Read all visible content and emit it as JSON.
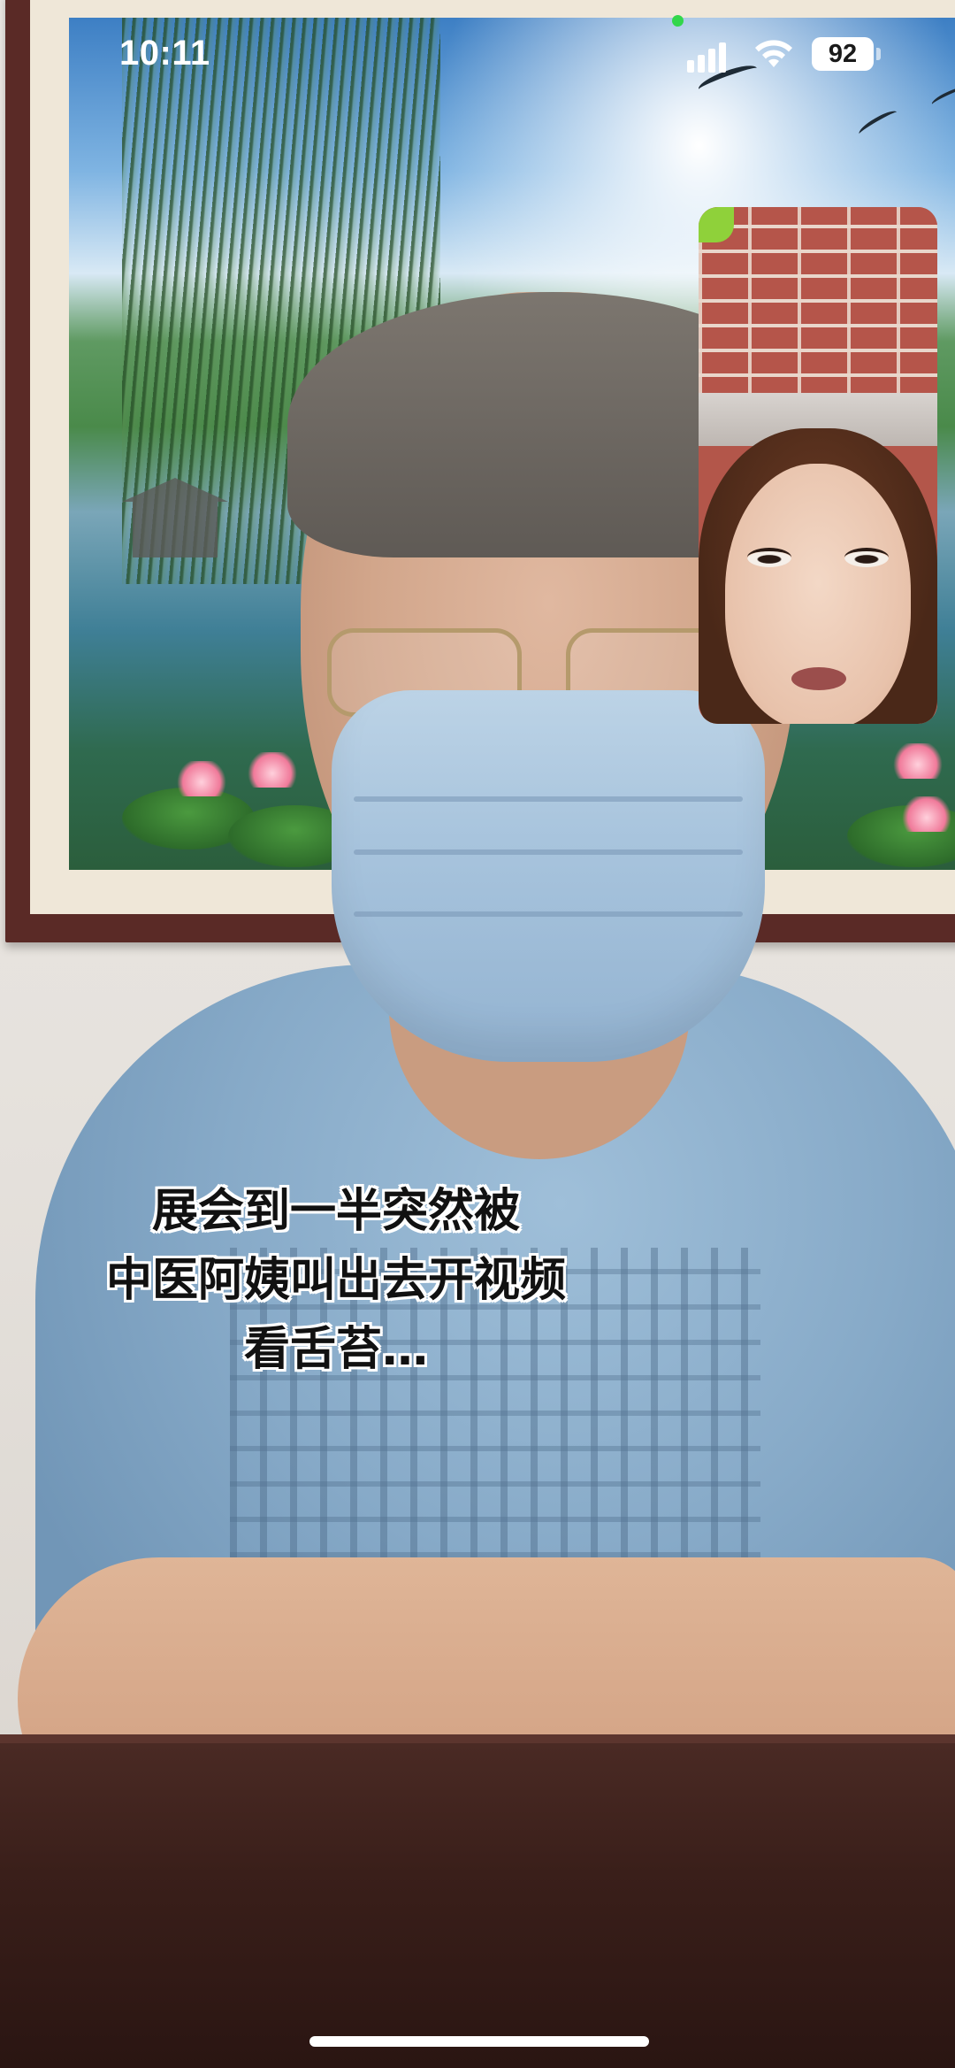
{
  "status_bar": {
    "time": "10:11",
    "battery_level": "92",
    "icons": [
      "signal-icon",
      "wifi-icon",
      "battery-icon"
    ],
    "mic_indicator_color": "#32d74b"
  },
  "call": {
    "remote_feed": "remote-video",
    "self_view": "self-view"
  },
  "caption": {
    "lines": [
      "展会到一半突然被",
      "中医阿姨叫出去开视频",
      "看舌苔…"
    ],
    "text_color": "#111111",
    "outline_color": "#ffffff"
  }
}
